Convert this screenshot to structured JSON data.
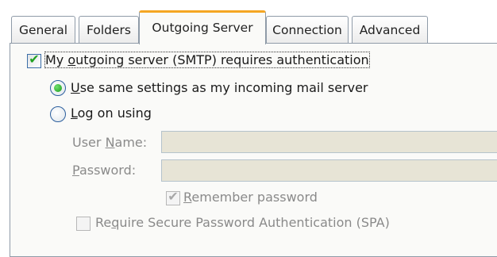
{
  "tabs": [
    {
      "label": "General"
    },
    {
      "label": "Folders"
    },
    {
      "label": "Outgoing Server",
      "active": true
    },
    {
      "label": "Connection"
    },
    {
      "label": "Advanced"
    }
  ],
  "smtp_auth": {
    "label_prefix": "My ",
    "label_accel": "o",
    "label_rest": "utgoing server (SMTP) requires authentication",
    "checked": true
  },
  "use_same": {
    "label_accel": "U",
    "label_rest": "se same settings as my incoming mail server",
    "selected": true
  },
  "log_on": {
    "label_accel": "L",
    "label_rest": "og on using",
    "selected": false
  },
  "username": {
    "label_prefix": "User ",
    "label_accel": "N",
    "label_rest": "ame:",
    "value": ""
  },
  "password": {
    "label_accel": "P",
    "label_rest": "assword:",
    "value": ""
  },
  "remember": {
    "label_accel": "R",
    "label_rest": "emember password",
    "checked": true
  },
  "spa": {
    "label_prefix": "Re",
    "label_accel": "q",
    "label_rest": "uire Secure Password Authentication (SPA)",
    "checked": false
  },
  "colors": {
    "active_tab_accent": "#f5a623",
    "check_green": "#21a121",
    "field_disabled": "#e7e4d6"
  }
}
